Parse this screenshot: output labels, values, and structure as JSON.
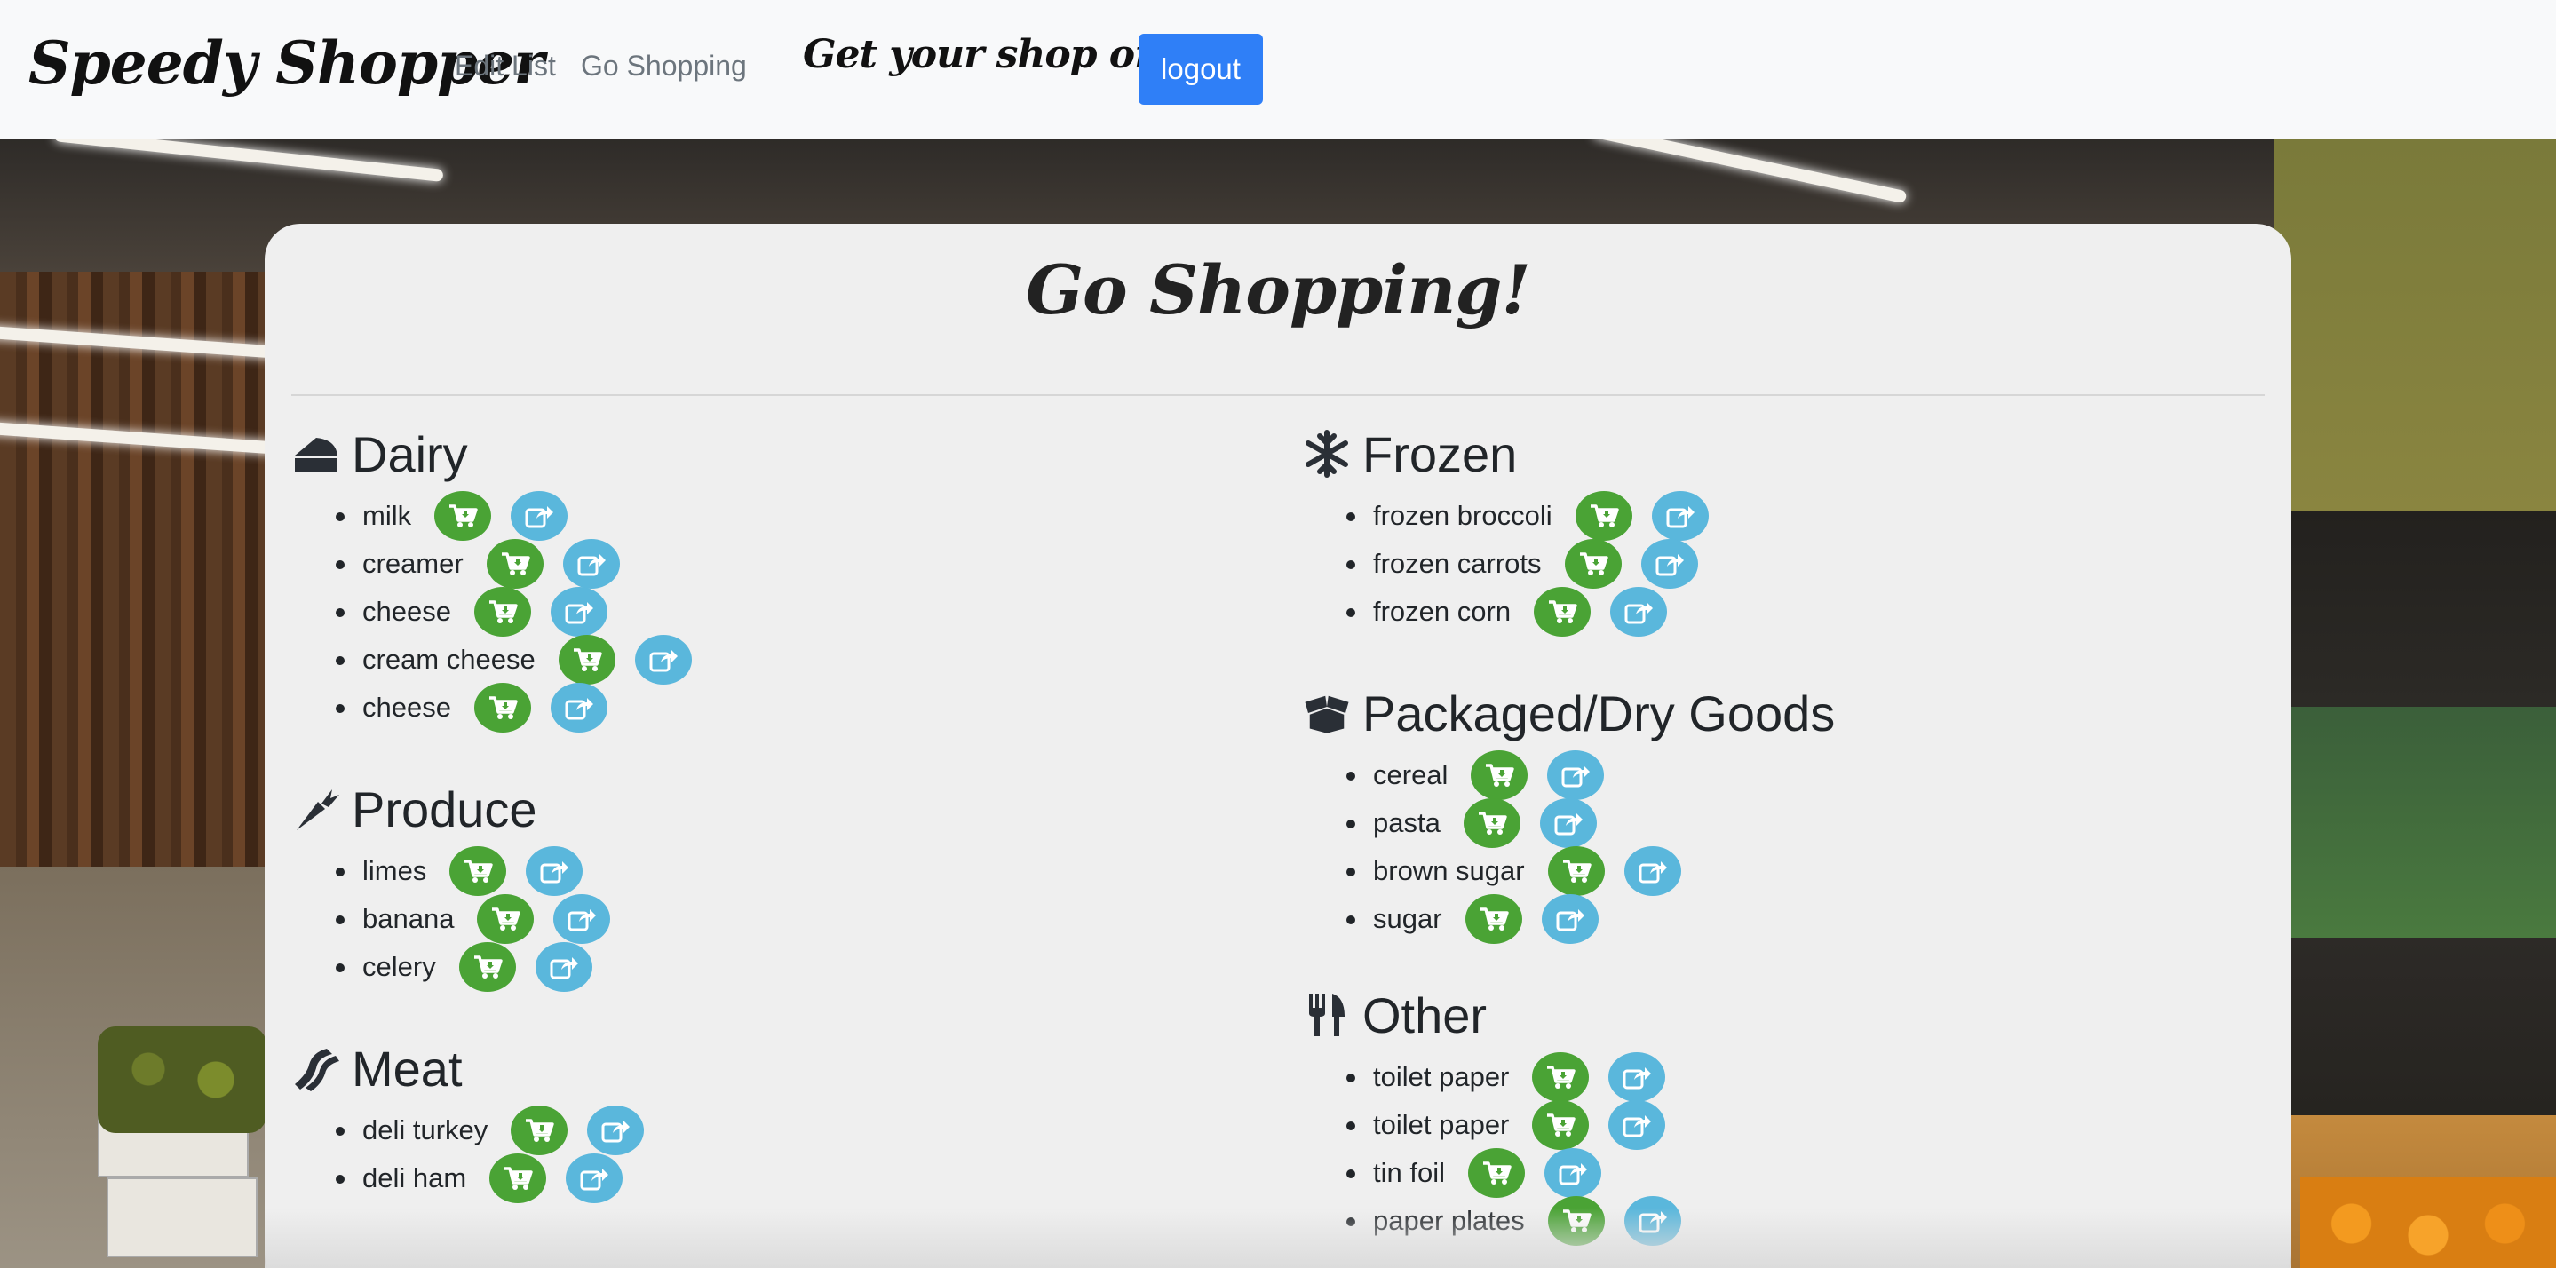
{
  "navbar": {
    "brand": "Speedy Shopper",
    "links": [
      "Edit List",
      "Go Shopping"
    ],
    "tagline": "Get your shop on  !",
    "logout_label": "logout"
  },
  "page": {
    "title": "Go Shopping!"
  },
  "colors": {
    "cart_button": "#4aa335",
    "share_button": "#5ab7dc",
    "logout_button": "#2f7ff7"
  },
  "categories_left": [
    {
      "title": "Dairy",
      "icon": "cheese-icon",
      "items": [
        "milk",
        "creamer",
        "cheese",
        "cream cheese",
        "cheese"
      ]
    },
    {
      "title": "Produce",
      "icon": "carrot-icon",
      "items": [
        "limes",
        "banana",
        "celery"
      ]
    },
    {
      "title": "Meat",
      "icon": "bacon-icon",
      "items": [
        "deli turkey",
        "deli ham"
      ]
    }
  ],
  "categories_right": [
    {
      "title": "Frozen",
      "icon": "snowflake-icon",
      "items": [
        "frozen broccoli",
        "frozen carrots",
        "frozen corn"
      ]
    },
    {
      "title": "Packaged/Dry Goods",
      "icon": "box-open-icon",
      "items": [
        "cereal",
        "pasta",
        "brown sugar",
        "sugar"
      ]
    },
    {
      "title": "Other",
      "icon": "utensils-icon",
      "items": [
        "toilet paper",
        "toilet paper",
        "tin foil",
        "paper plates"
      ]
    }
  ]
}
